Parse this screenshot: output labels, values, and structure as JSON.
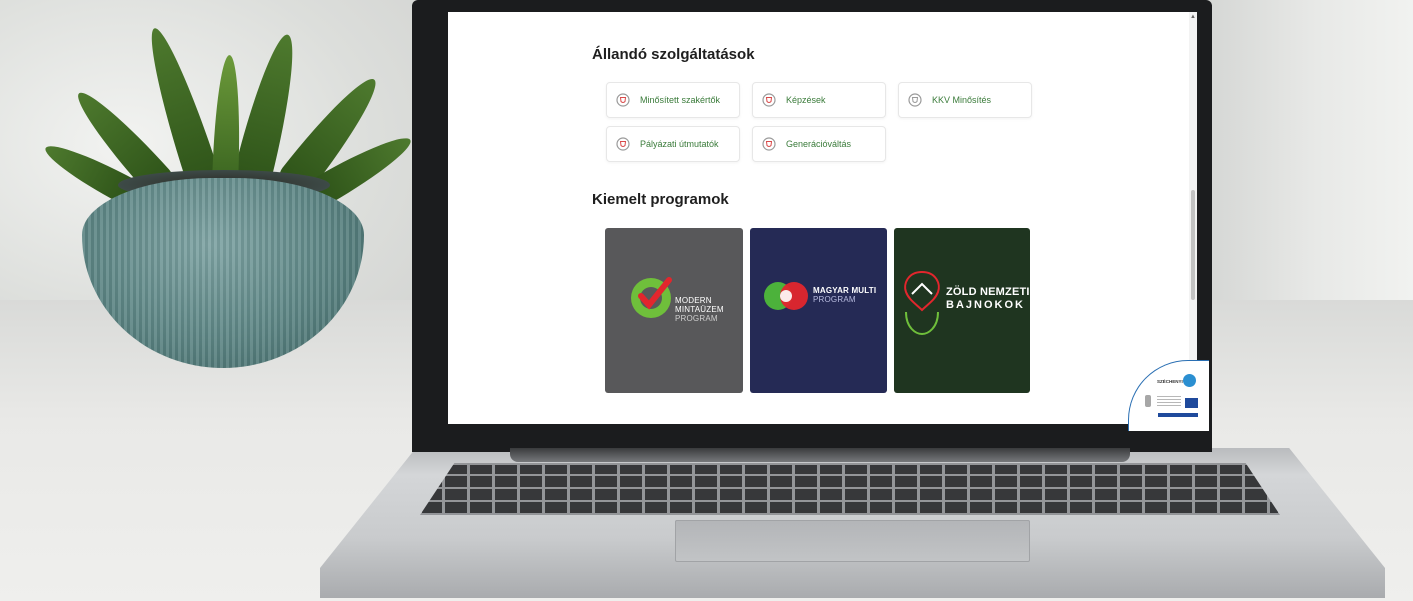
{
  "page": {
    "sections": {
      "services_title": "Állandó szolgáltatások",
      "programs_title": "Kiemelt programok"
    },
    "services": [
      {
        "label": "Minősített szakértők",
        "icon": "shield-icon"
      },
      {
        "label": "Képzések",
        "icon": "shield-icon"
      },
      {
        "label": "KKV Minősítés",
        "icon": "shield-icon"
      },
      {
        "label": "Pályázati útmutatók",
        "icon": "shield-icon"
      },
      {
        "label": "Generációváltás",
        "icon": "shield-icon"
      }
    ],
    "programs": [
      {
        "lines": [
          "MODERN",
          "MINTAÜZEM",
          "PROGRAM"
        ],
        "color": "#58585a"
      },
      {
        "lines": [
          "MAGYAR MULTI",
          "PROGRAM"
        ],
        "color": "#252a55"
      },
      {
        "lines": [
          "ZÖLD NEMZETI",
          "BAJNOKOK"
        ],
        "color": "#1f3520"
      }
    ],
    "badge": {
      "title": "SZÉCHENYI"
    }
  },
  "colors": {
    "accent_green": "#3a7b3a",
    "accent_red": "#d94a4a"
  }
}
